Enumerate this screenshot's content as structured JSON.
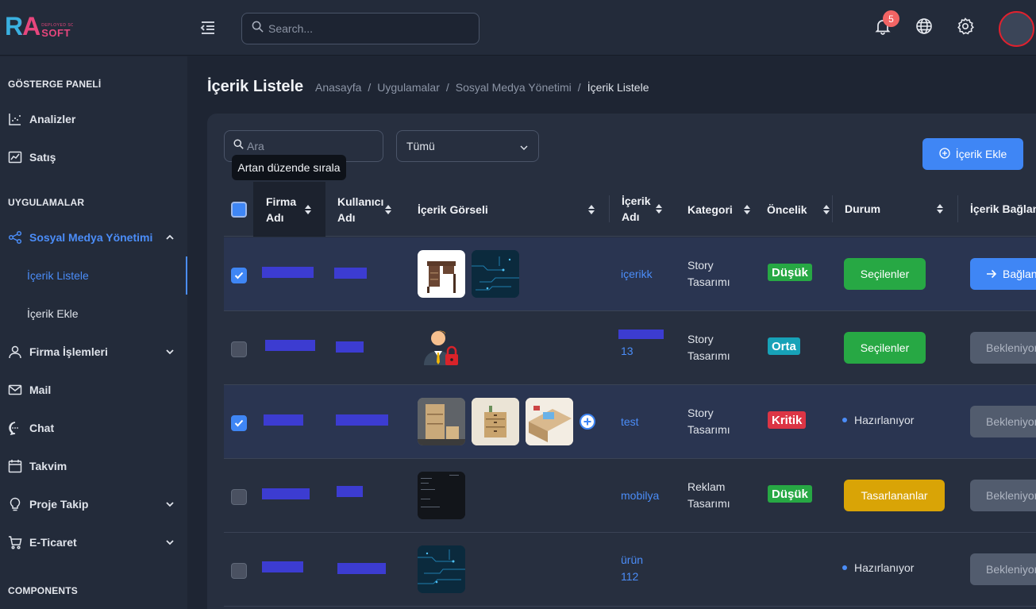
{
  "topbar": {
    "logo_main": "RA",
    "logo_tagline": "DEPLOYED SOMEWHERE IN THE FUTURE",
    "logo_sub": "SOFT",
    "search_placeholder": "Search...",
    "notification_count": "5",
    "icons": [
      "menu-toggle-icon",
      "bell-icon",
      "globe-icon",
      "gear-icon"
    ]
  },
  "sidebar": {
    "sections": [
      "GÖSTERGE PANELİ",
      "UYGULAMALAR",
      "COMPONENTS"
    ],
    "dashboard_items": [
      {
        "label": "Analizler",
        "icon": "chart-icon"
      },
      {
        "label": "Satış",
        "icon": "trend-icon"
      }
    ],
    "app_items": [
      {
        "label": "Sosyal Medya Yönetimi",
        "icon": "share-icon",
        "expanded": true
      },
      {
        "label": "Firma İşlemleri",
        "icon": "user-icon"
      },
      {
        "label": "Mail",
        "icon": "mail-icon"
      },
      {
        "label": "Chat",
        "icon": "chat-icon"
      },
      {
        "label": "Takvim",
        "icon": "calendar-icon"
      },
      {
        "label": "Proje Takip",
        "icon": "bulb-icon"
      },
      {
        "label": "E-Ticaret",
        "icon": "cart-icon"
      }
    ],
    "sub_items": [
      "İçerik Listele",
      "İçerik Ekle"
    ]
  },
  "page": {
    "title": "İçerik Listele",
    "breadcrumb": [
      "Anasayfa",
      "/",
      "Uygulamalar",
      "/",
      "Sosyal Medya Yönetimi",
      "/",
      "İçerik Listele"
    ]
  },
  "toolbar": {
    "search_placeholder": "Ara",
    "filter_value": "Tümü",
    "add_label": "İçerik Ekle",
    "tooltip": "Artan düzende sırala"
  },
  "table": {
    "headers": {
      "firma": [
        "Firma",
        "Adı"
      ],
      "kullanici": [
        "Kullanıcı",
        "Adı"
      ],
      "gorsel": "İçerik Görseli",
      "icerik": [
        "İçerik",
        "Adı"
      ],
      "kategori": "Kategori",
      "oncelik": "Öncelik",
      "durum": "Durum",
      "baglanti": "İçerik Bağlantısı"
    },
    "rows": [
      {
        "checked": true,
        "content_lines": [
          "içerikk"
        ],
        "category": [
          "Story",
          "Tasarımı"
        ],
        "priority": "Düşük",
        "priority_color": "#27a844",
        "status": "Seçilenler",
        "status_type": "button",
        "status_color": "#27a844",
        "action": "Bağlantı",
        "action_type": "primary"
      },
      {
        "checked": false,
        "content_lines": [
          "13"
        ],
        "category": [
          "Story",
          "Tasarımı"
        ],
        "priority": "Orta",
        "priority_color": "#17a2b8",
        "status": "Seçilenler",
        "status_type": "button",
        "status_color": "#27a844",
        "action": "Bekleniyor",
        "action_type": "muted"
      },
      {
        "checked": true,
        "content_lines": [
          "test"
        ],
        "category": [
          "Story",
          "Tasarımı"
        ],
        "priority": "Kritik",
        "priority_color": "#dc3545",
        "status": "Hazırlanıyor",
        "status_type": "dot",
        "action": "Bekleniyor",
        "action_type": "muted"
      },
      {
        "checked": false,
        "content_lines": [
          "mobilya"
        ],
        "category": [
          "Reklam",
          "Tasarımı"
        ],
        "priority": "Düşük",
        "priority_color": "#27a844",
        "status": "Tasarlananlar",
        "status_type": "button",
        "status_color": "#d9a406",
        "action": "Bekleniyor",
        "action_type": "muted"
      },
      {
        "checked": false,
        "content_lines": [
          "ürün",
          "112"
        ],
        "category": [],
        "priority": "",
        "status": "Hazırlanıyor",
        "status_type": "dot",
        "action": "Bekleniyor",
        "action_type": "muted"
      }
    ]
  }
}
